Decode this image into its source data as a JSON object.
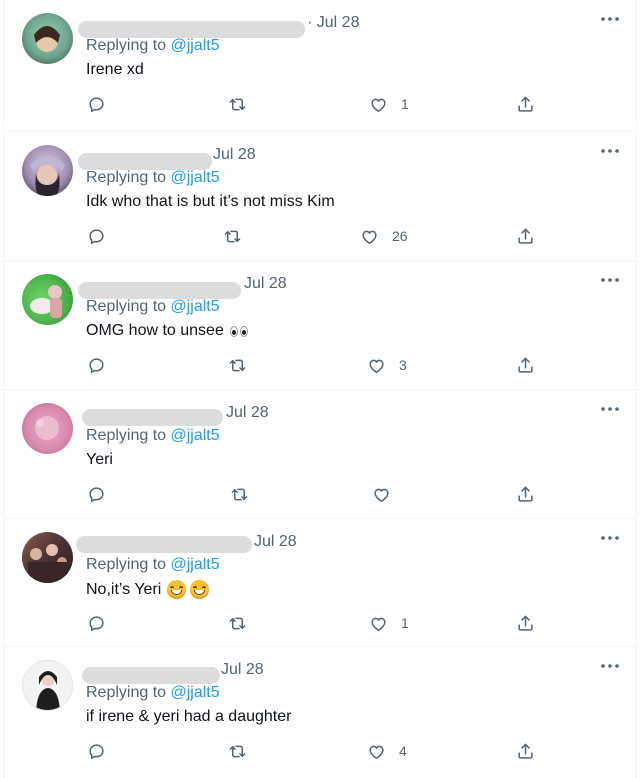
{
  "tweets": [
    {
      "date": "· Jul 28",
      "reply_prefix": "Replying to",
      "reply_handle": "@jjalt5",
      "text": "Irene xd",
      "likes": "1",
      "avatar_colors": [
        "#7fb7a3",
        "#3d4a3a"
      ]
    },
    {
      "date": "Jul 28",
      "reply_prefix": "Replying to",
      "reply_handle": "@jjalt5",
      "text": "Idk who that is but it’s not miss Kim",
      "likes": "26",
      "avatar_colors": [
        "#c9b7d6",
        "#2b2330"
      ]
    },
    {
      "date": "Jul 28",
      "reply_prefix": "Replying to",
      "reply_handle": "@jjalt5",
      "text": "OMG how to unsee",
      "likes": "3",
      "avatar_colors": [
        "#5cc35a",
        "#e8c6c6"
      ]
    },
    {
      "date": "Jul 28",
      "reply_prefix": "Replying to",
      "reply_handle": "@jjalt5",
      "text": "Yeri",
      "likes": "",
      "avatar_colors": [
        "#d98bb0",
        "#c66f97"
      ]
    },
    {
      "date": "Jul 28",
      "reply_prefix": "Replying to",
      "reply_handle": "@jjalt5",
      "text": "No,it’s Yeri",
      "likes": "1",
      "avatar_colors": [
        "#8a5a4a",
        "#2d2224"
      ]
    },
    {
      "date": "Jul 28",
      "reply_prefix": "Replying to",
      "reply_handle": "@jjalt5",
      "text": "if irene & yeri had a daughter",
      "likes": "4",
      "avatar_colors": [
        "#f3f3f3",
        "#1e1e1e"
      ]
    }
  ],
  "icons": {
    "reply": "reply-icon",
    "retweet": "retweet-icon",
    "like": "heart-icon",
    "share": "share-icon",
    "more": "more-icon"
  },
  "colors": {
    "link": "#1d9bf0",
    "muted": "#536471",
    "text": "#0f1419"
  }
}
